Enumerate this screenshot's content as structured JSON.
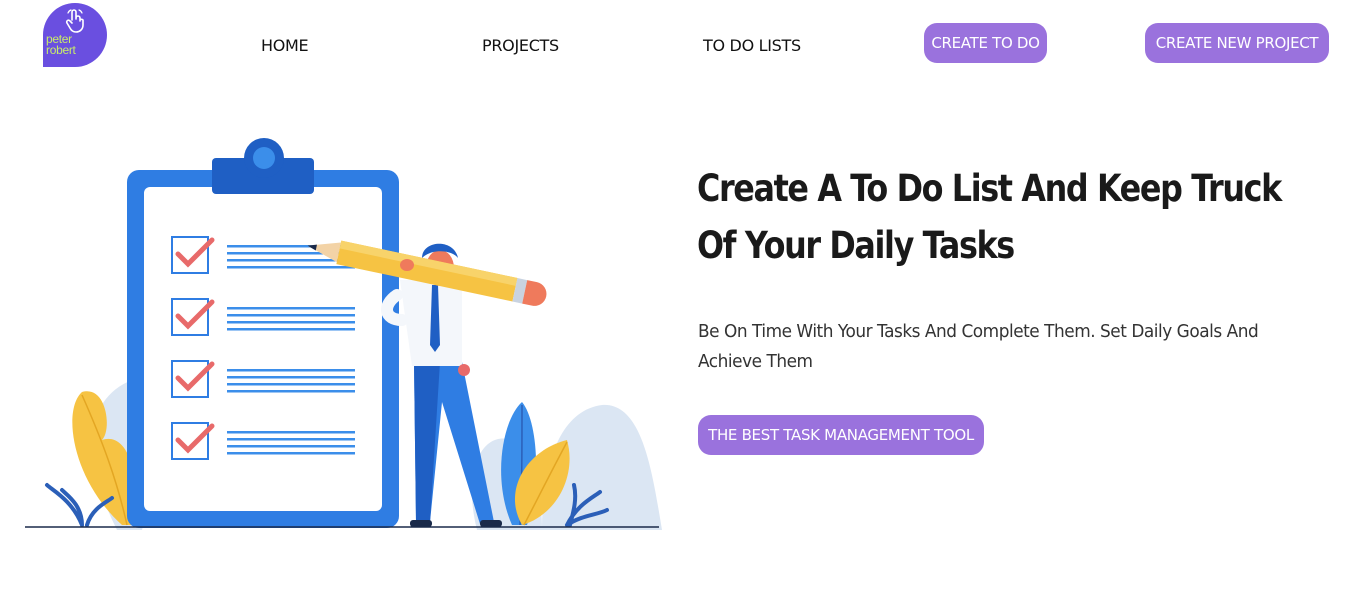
{
  "logo": {
    "line1": "peter",
    "line2": "robert",
    "icon": "hand-pointer-icon"
  },
  "nav": {
    "home": "HOME",
    "projects": "PROJECTS",
    "todo_lists": "TO DO LISTS"
  },
  "header_buttons": {
    "create_todo": "CREATE TO DO",
    "create_project": "CREATE NEW PROJECT"
  },
  "hero": {
    "title": "Create A To Do List And Keep Truck Of Your Daily Tasks",
    "subtitle": "Be On Time With Your Tasks And Complete Them. Set Daily Goals And Achieve Them",
    "cta": "THE BEST TASK MANAGEMENT TOOL",
    "illustration": "clipboard-checklist-with-person-holding-pencil"
  },
  "colors": {
    "accent": "#9a72dd",
    "logo_bg": "#6a4fe0",
    "logo_text": "#c8ec6a",
    "clipboard_blue": "#3b8eea",
    "check_red": "#e86a6a",
    "leaf_yellow": "#f6c343"
  }
}
